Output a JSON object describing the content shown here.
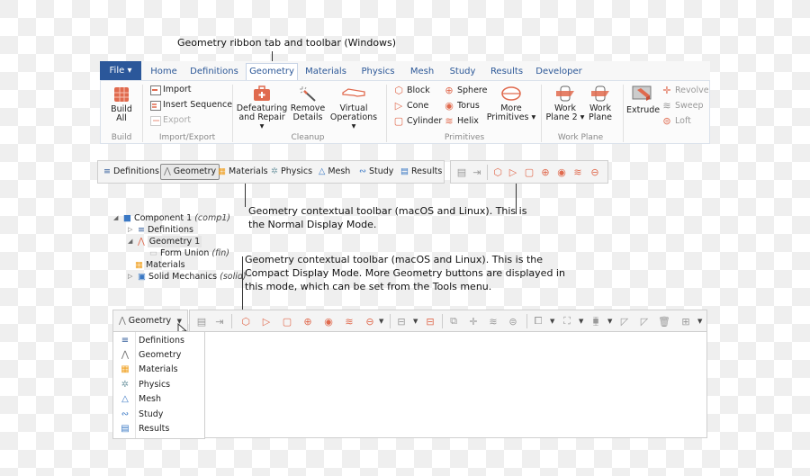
{
  "captions": {
    "ribbon": "Geometry ribbon tab and toolbar (Windows)",
    "normal_line1": "Geometry contextual toolbar (macOS and Linux). This is",
    "normal_line2": "the Normal Display Mode.",
    "compact_line1": "Geometry contextual toolbar (macOS and Linux). This is the",
    "compact_line2": "Compact Display Mode. More Geometry buttons are displayed in",
    "compact_line3": "this mode, which can be set from the Tools menu."
  },
  "ribbon": {
    "file_label": "File ▾",
    "tabs": [
      "Home",
      "Definitions",
      "Geometry",
      "Materials",
      "Physics",
      "Mesh",
      "Study",
      "Results",
      "Developer"
    ],
    "active_tab": "Geometry",
    "groups": {
      "build": {
        "label": "Build",
        "build_all_line1": "Build",
        "build_all_line2": "All"
      },
      "import_export": {
        "label": "Import/Export",
        "import": "Import",
        "insert_sequence": "Insert Sequence",
        "export": "Export"
      },
      "cleanup": {
        "label": "Cleanup",
        "defeaturing_line1": "Defeaturing",
        "defeaturing_line2": "and Repair ▾",
        "remove_line1": "Remove",
        "remove_line2": "Details",
        "virtual_line1": "Virtual",
        "virtual_line2": "Operations ▾"
      },
      "primitives": {
        "label": "Primitives",
        "block": "Block",
        "cone": "Cone",
        "cylinder": "Cylinder",
        "sphere": "Sphere",
        "torus": "Torus",
        "helix": "Helix",
        "more_line1": "More",
        "more_line2": "Primitives ▾"
      },
      "work_plane": {
        "label": "Work Plane",
        "wp2_line1": "Work",
        "wp2_line2": "Plane 2 ▾",
        "wp_line1": "Work",
        "wp_line2": "Plane"
      },
      "operations": {
        "extrude": "Extrude",
        "revolve": "Revolve",
        "sweep": "Sweep",
        "loft": "Loft"
      }
    }
  },
  "normal_toolbar": {
    "items": [
      "Definitions",
      "Geometry",
      "Materials",
      "Physics",
      "Mesh",
      "Study",
      "Results"
    ],
    "selected": "Geometry"
  },
  "tree": {
    "component": "Component 1",
    "component_tag": "(comp1)",
    "definitions": "Definitions",
    "geometry": "Geometry 1",
    "form_union": "Form Union",
    "form_union_tag": "(fin)",
    "materials": "Materials",
    "solid_mechanics": "Solid Mechanics",
    "solid_mechanics_tag": "(solid)"
  },
  "compact_toolbar": {
    "selector_label": "Geometry",
    "dropdown_items": [
      "Definitions",
      "Geometry",
      "Materials",
      "Physics",
      "Mesh",
      "Study",
      "Results"
    ]
  }
}
